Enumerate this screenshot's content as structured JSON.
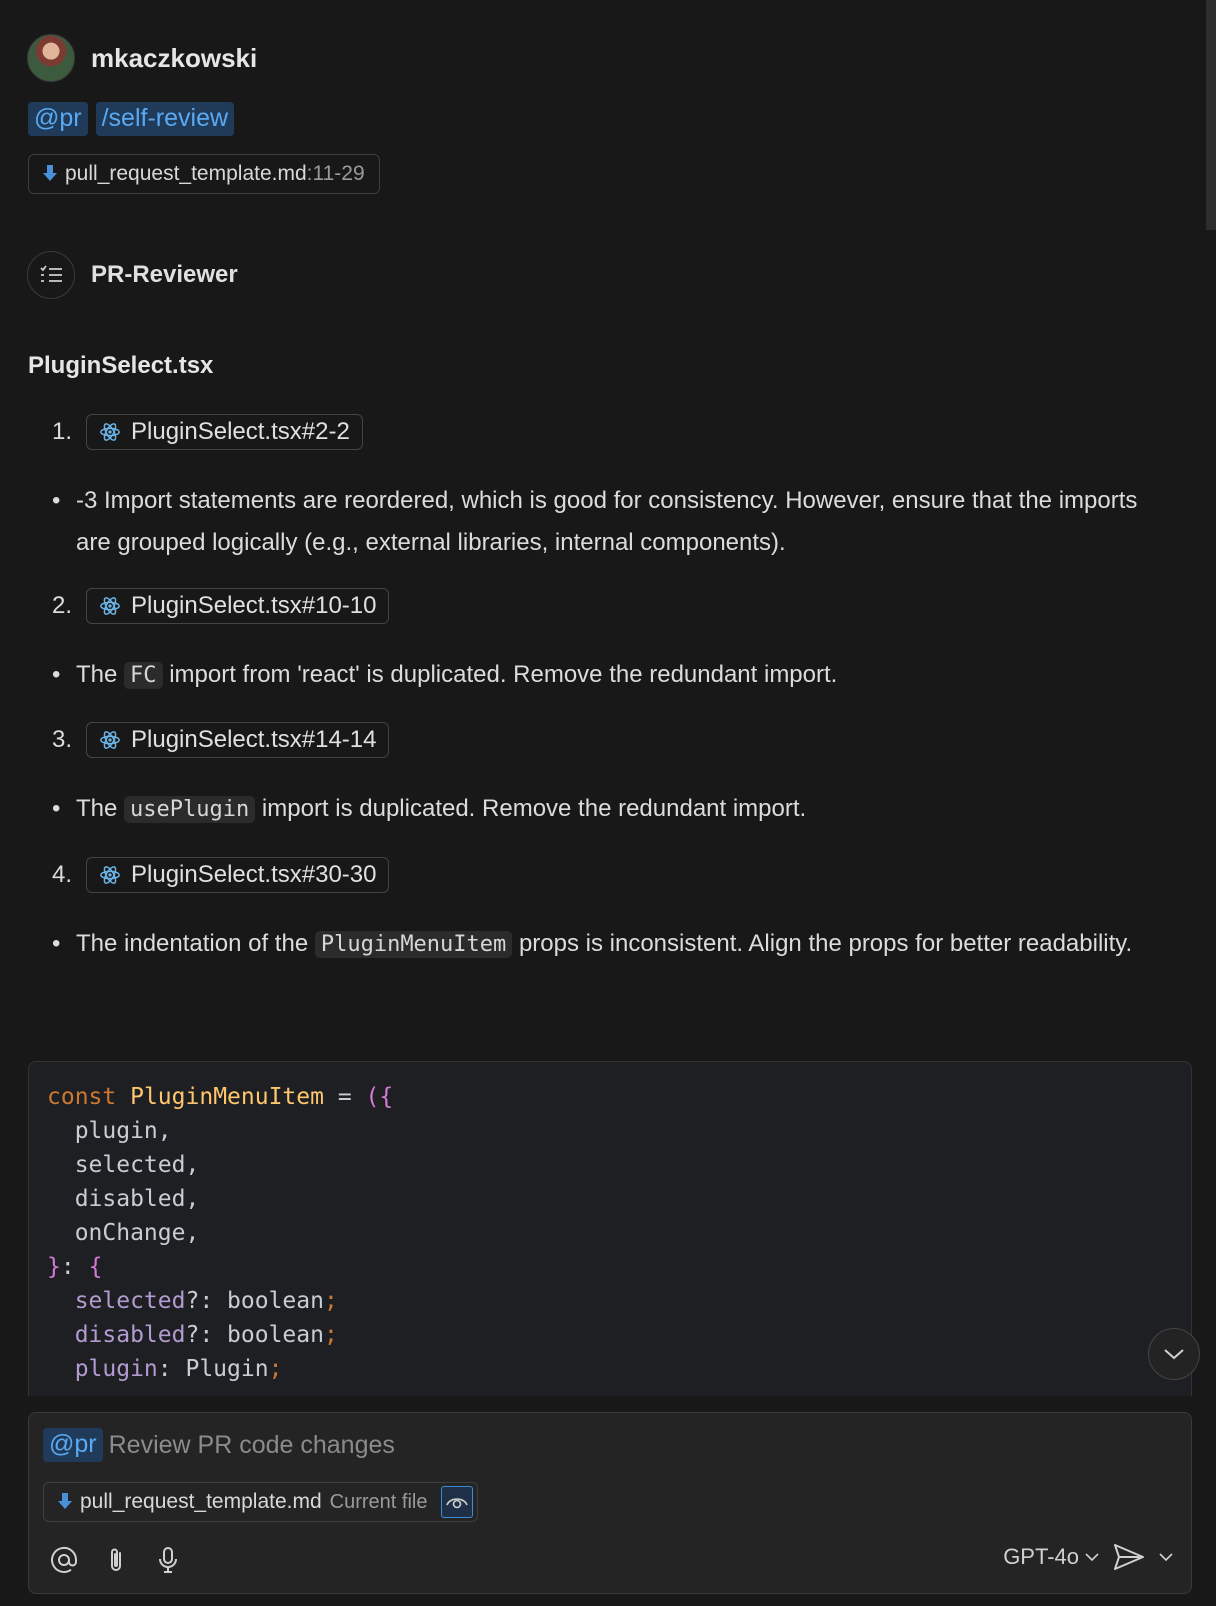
{
  "user": {
    "name": "mkaczkowski"
  },
  "mentions": [
    "@pr",
    "/self-review"
  ],
  "attached_file": {
    "name": "pull_request_template.md",
    "range": ":11-29"
  },
  "agent": {
    "name": "PR-Reviewer"
  },
  "section_title": "PluginSelect.tsx",
  "items": [
    {
      "num": "1.",
      "ref": "PluginSelect.tsx#2-2"
    },
    {
      "num": "2.",
      "ref": "PluginSelect.tsx#10-10"
    },
    {
      "num": "3.",
      "ref": "PluginSelect.tsx#14-14"
    },
    {
      "num": "4.",
      "ref": "PluginSelect.tsx#30-30"
    }
  ],
  "bullets": {
    "b1": "-3 Import statements are reordered, which is good for consistency. However, ensure that the imports are grouped logically (e.g., external libraries, internal components).",
    "b2_pre": "The ",
    "b2_code": "FC",
    "b2_post": " import from 'react' is duplicated. Remove the redundant import.",
    "b3_pre": "The ",
    "b3_code": "usePlugin",
    "b3_post": " import is duplicated. Remove the redundant import.",
    "b4_pre": "The indentation of the ",
    "b4_code": "PluginMenuItem",
    "b4_post": " props is inconsistent. Align the props for better readability."
  },
  "code": {
    "l1_kw": "const",
    "l1_fn": "PluginMenuItem",
    "l1_eq": " = ",
    "l1_br": "({",
    "l2": "  plugin,",
    "l3": "  selected,",
    "l4": "  disabled,",
    "l5": "  onChange,",
    "l6_br": "}",
    "l6_mid": ": ",
    "l6_br2": "{",
    "l7_pr": "  selected",
    "l7_rest": "?: boolean",
    "l7_p": ";",
    "l8_pr": "  disabled",
    "l8_rest": "?: boolean",
    "l8_p": ";",
    "l9_pr": "  plugin",
    "l9_rest": ": Plugin",
    "l9_p": ";"
  },
  "input": {
    "mention": "@pr",
    "placeholder": "Review PR code changes",
    "file_name": "pull_request_template.md",
    "current_file_label": "Current file",
    "model": "GPT-4o"
  },
  "icons": {
    "file": "markdown-file-icon",
    "react": "react-icon",
    "agent": "list-icon",
    "at": "at-icon",
    "attach": "paperclip-icon",
    "mic": "microphone-icon",
    "send": "send-icon",
    "eye": "eye-icon",
    "chevron": "chevron-down-icon"
  },
  "colors": {
    "background": "#181818",
    "mention_bg": "#1f3b59",
    "mention_text": "#5aa9f2",
    "accent": "#3c8dd6"
  }
}
